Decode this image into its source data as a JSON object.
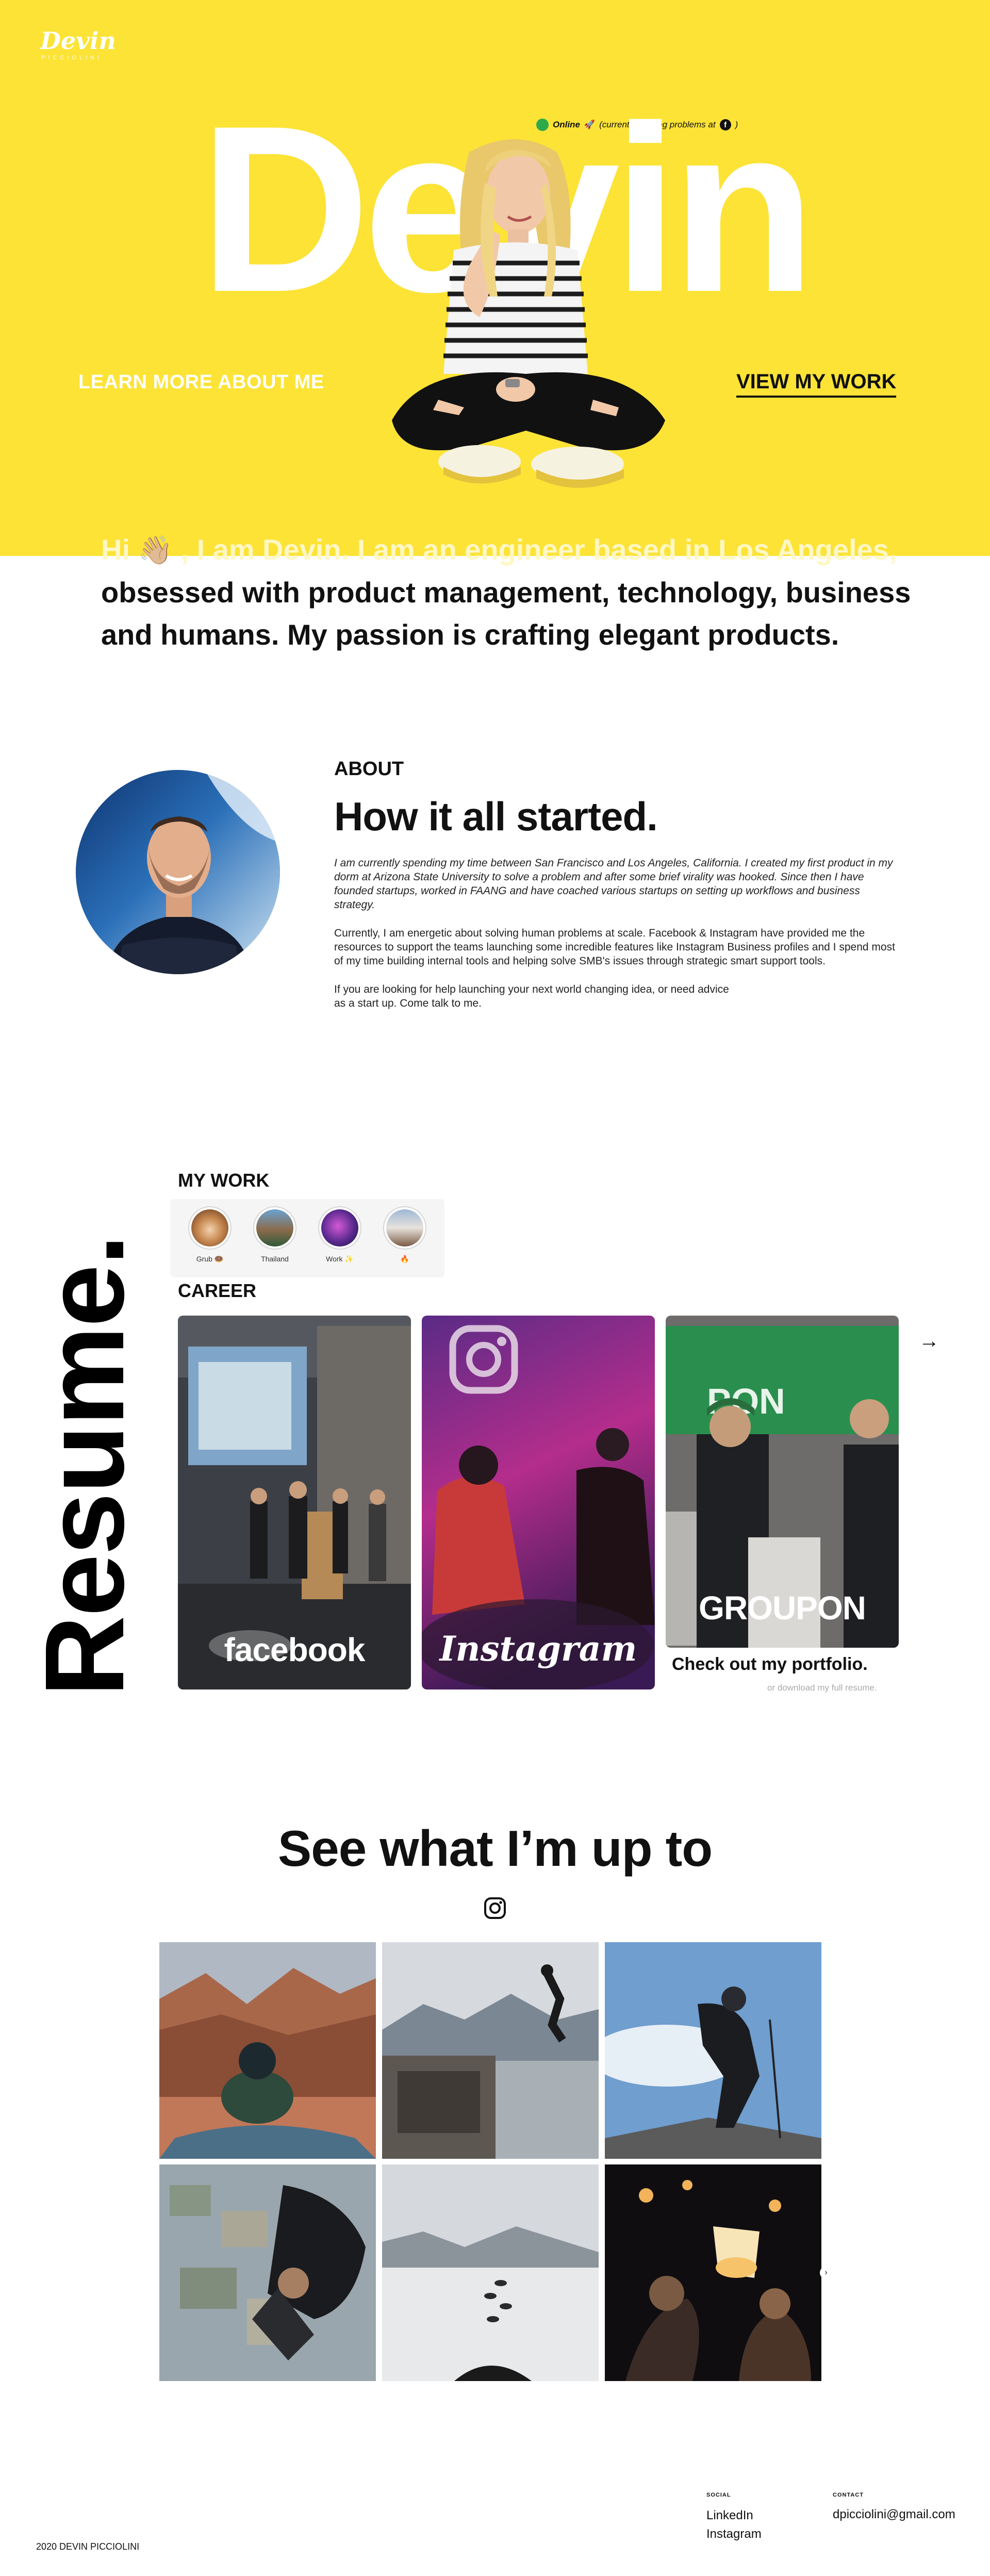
{
  "hero": {
    "logo_name": "Devin",
    "logo_sub": "PICCIOLINI",
    "status_online": "Online",
    "status_rocket": "🚀",
    "status_note": "(currently, solving problems at",
    "status_close": ")",
    "status_company_glyph": "f",
    "big_name": "Devin",
    "learn_more": "LEARN MORE ABOUT ME",
    "view_work": "VIEW MY WORK",
    "accent_color": "#FCE336"
  },
  "intro": {
    "line1_hi": "Hi",
    "line1_emoji": "👋🏼",
    "line1_rest": ", I am Devin. I am an engineer based in Los Angeles,",
    "line2": "obsessed with product management, technology, business",
    "line3": "and humans. My passion is crafting elegant products."
  },
  "about": {
    "label": "ABOUT",
    "title": "How it all started.",
    "p1": "I am currently spending my time between San Francisco and Los Angeles, California. I created my first product in my dorm at Arizona State University to solve a problem and after some brief virality was hooked. Since then I have founded startups, worked in FAANG and have coached various startups on setting up workflows and business strategy.",
    "p2": "Currently, I am energetic about solving human problems at scale. Facebook & Instagram have provided me the resources to support the teams launching some incredible features like Instagram Business profiles and I spend most of my time building internal tools and helping solve SMB's issues through strategic smart support tools.",
    "p3a": "If you are looking for help launching your next world changing idea, or need advice",
    "p3b": "as a start up. Come talk to me."
  },
  "resume": {
    "vertical_word": "Resume.",
    "my_work_label": "MY WORK",
    "stories": [
      {
        "label": "Grub 🍩"
      },
      {
        "label": "Thailand"
      },
      {
        "label": "Work ✨"
      },
      {
        "label": "🔥"
      }
    ],
    "career_label": "CAREER",
    "cards": [
      {
        "word": "facebook"
      },
      {
        "word": "Instagram"
      },
      {
        "word": "GROUPON"
      }
    ],
    "next_arrow": "→",
    "portfolio_link": "Check out my portfolio.",
    "download_link": "or download my full resume."
  },
  "instagram": {
    "title": "See what I’m up to",
    "grid_next": "›"
  },
  "footer": {
    "copyright": "2020 DEVIN PICCIOLINI",
    "social_heading": "SOCIAL",
    "contact_heading": "CONTACT",
    "linkedin": "LinkedIn",
    "instagram": "Instagram",
    "email": "dpicciolini@gmail.com"
  }
}
